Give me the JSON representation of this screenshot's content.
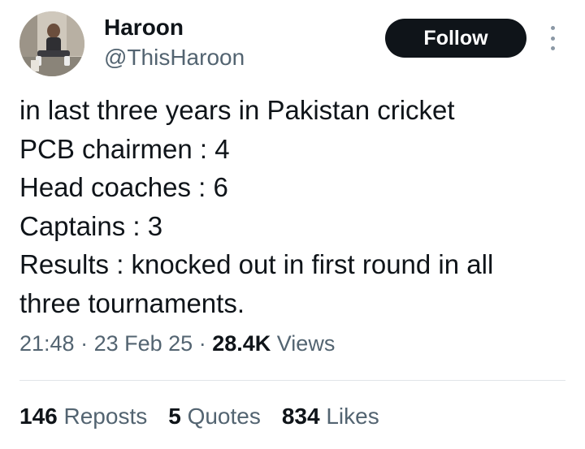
{
  "author": {
    "display_name": "Haroon",
    "handle": "@ThisHaroon",
    "avatar_icon": "user-avatar"
  },
  "follow_label": "Follow",
  "more_icon": "more-vertical-icon",
  "tweet": {
    "lines": [
      "in last three years in Pakistan cricket",
      "PCB chairmen : 4",
      "Head coaches : 6",
      "Captains : 3",
      "Results : knocked out in first round in all",
      "three tournaments."
    ]
  },
  "meta": {
    "time": "21:48",
    "date": "23 Feb 25",
    "views_count": "28.4K",
    "views_label": "Views"
  },
  "stats": {
    "reposts_count": "146",
    "reposts_label": "Reposts",
    "quotes_count": "5",
    "quotes_label": "Quotes",
    "likes_count": "834",
    "likes_label": "Likes"
  },
  "colors": {
    "text_primary": "#0f1419",
    "text_secondary": "#536471",
    "button_bg": "#0f1419",
    "button_text": "#ffffff",
    "divider": "#e1e5e8"
  }
}
